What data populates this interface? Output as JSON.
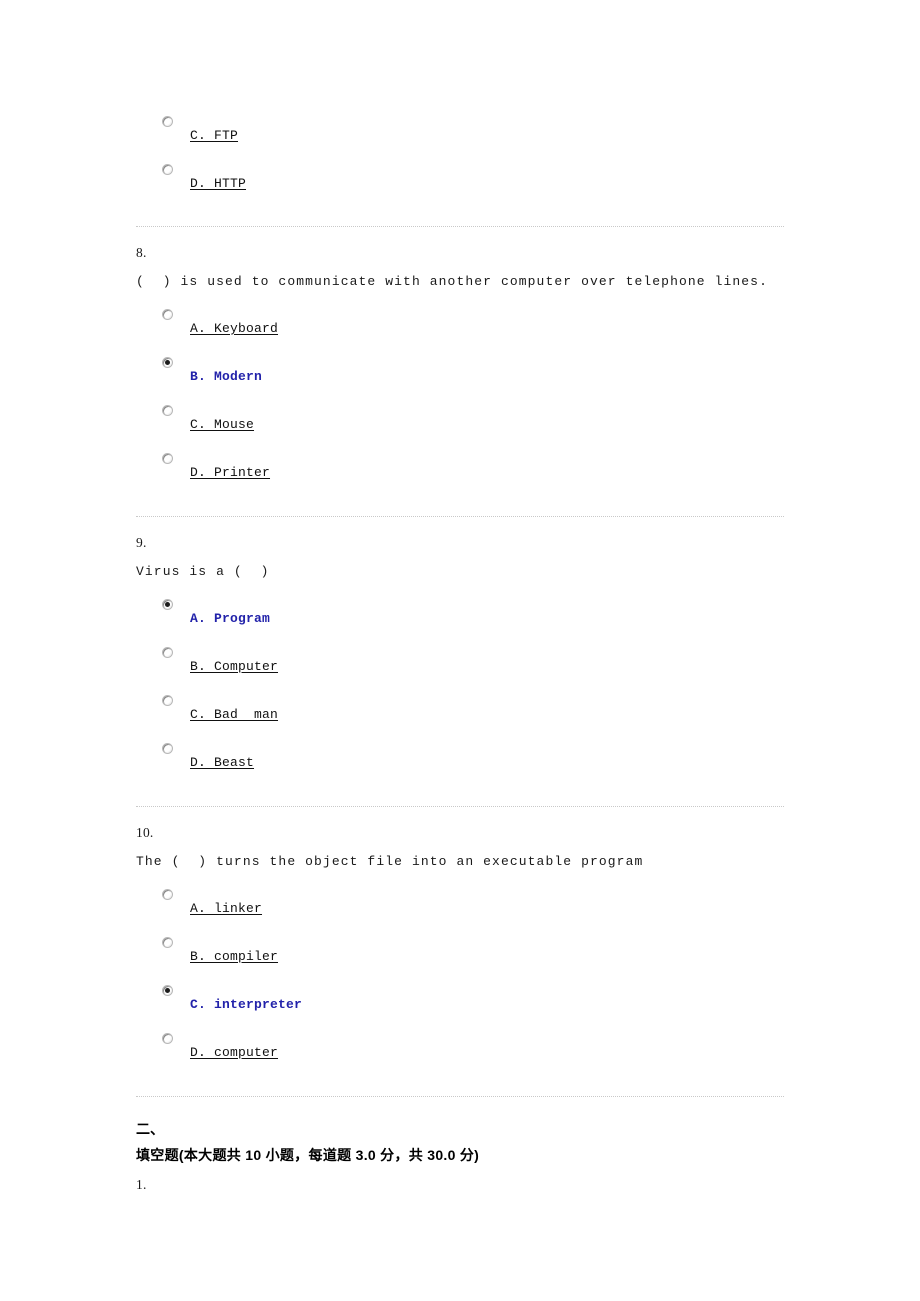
{
  "questions": [
    {
      "number": "",
      "stem": "",
      "options": [
        {
          "label": "C. FTP",
          "selected": false
        },
        {
          "label": "D. HTTP",
          "selected": false
        }
      ]
    },
    {
      "number": "8.",
      "stem": "(  ) is used to communicate with another computer over telephone lines.",
      "options": [
        {
          "label": "A. Keyboard",
          "selected": false
        },
        {
          "label": "B. Modern",
          "selected": true
        },
        {
          "label": "C. Mouse",
          "selected": false
        },
        {
          "label": "D. Printer",
          "selected": false
        }
      ]
    },
    {
      "number": "9.",
      "stem": "Virus is a (  )",
      "options": [
        {
          "label": "A. Program",
          "selected": true
        },
        {
          "label": "B. Computer",
          "selected": false
        },
        {
          "label": "C. Bad  man",
          "selected": false
        },
        {
          "label": "D. Beast",
          "selected": false
        }
      ]
    },
    {
      "number": "10.",
      "stem": "The (  ) turns the object file into an executable program",
      "options": [
        {
          "label": "A. linker",
          "selected": false
        },
        {
          "label": "B. compiler",
          "selected": false
        },
        {
          "label": "C. interpreter",
          "selected": true
        },
        {
          "label": "D. computer",
          "selected": false
        }
      ]
    }
  ],
  "section": {
    "index": "二、",
    "title": "填空题(本大题共 10 小题，每道题 3.0 分，共 30.0 分)",
    "next_question_number": "1."
  },
  "colors": {
    "selected_option": "#2222aa",
    "text": "#111111",
    "divider": "#c9c9c9"
  }
}
